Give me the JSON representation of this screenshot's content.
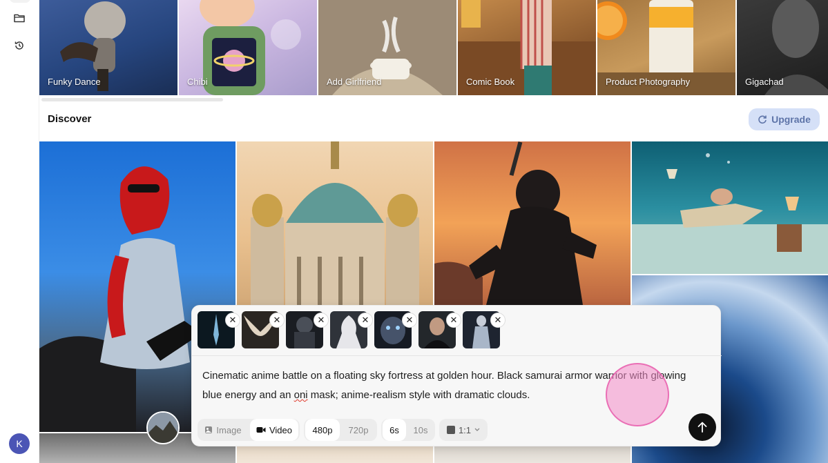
{
  "sidebar": {
    "folder_icon": "folder-icon",
    "history_icon": "history-icon",
    "user_initial": "K"
  },
  "styles": [
    {
      "label": "Funky Dance"
    },
    {
      "label": "Chibi"
    },
    {
      "label": "Add Girlfriend"
    },
    {
      "label": "Comic Book"
    },
    {
      "label": "Product Photography"
    },
    {
      "label": "Gigachad"
    }
  ],
  "discover": {
    "title": "Discover",
    "upgrade_label": "Upgrade"
  },
  "prompt": {
    "text_before": "Cinematic anime battle on a floating sky fortress at golden hour. Black samurai armor warrior with glowing blue energy and an ",
    "text_misspelled": "oni",
    "text_after": " mask; anime-realism style with dramatic clouds.",
    "remove_symbol": "✕"
  },
  "controls": {
    "mode_image": "Image",
    "mode_video": "Video",
    "res_480": "480p",
    "res_720": "720p",
    "dur_6": "6s",
    "dur_10": "10s",
    "aspect": "1:1"
  },
  "colors": {
    "accent_upgrade_bg": "#d5e0f7",
    "accent_upgrade_text": "#5e74a8",
    "avatar_bg": "#4b55b5",
    "send_bg": "#111111"
  }
}
